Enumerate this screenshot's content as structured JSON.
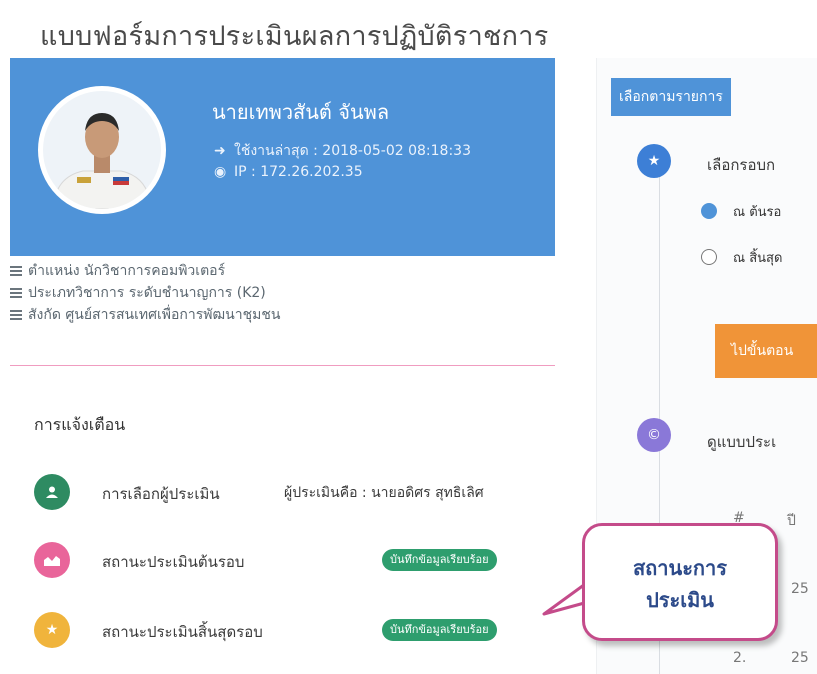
{
  "page": {
    "title": "แบบฟอร์มการประเมินผลการปฏิบัติราชการ"
  },
  "profile": {
    "name": "นายเทพวสันต์ จันพล",
    "last_login": "ใช้งานล่าสุด : 2018-05-02 08:18:33",
    "ip": "IP : 172.26.202.35",
    "info": [
      "ตำแหน่ง นักวิชาการคอมพิวเตอร์",
      "ประเภทวิชาการ ระดับชำนาญการ (K2)",
      "สังกัด ศูนย์สารสนเทศเพื่อการพัฒนาชุมชน"
    ]
  },
  "notifications": {
    "title": "การแจ้งเตือน",
    "items": [
      {
        "label": "การเลือกผู้ประเมิน",
        "value": "ผู้ประเมินคือ : นายอดิศร สุทธิเลิศ",
        "color": "#2e8b62"
      },
      {
        "label": "สถานะประเมินต้นรอบ",
        "badge": "บันทึกข้อมูลเรียบร้อย",
        "color": "#e9659a"
      },
      {
        "label": "สถานะประเมินสิ้นสุดรอบ",
        "badge": "บันทึกข้อมูลเรียบร้อย",
        "color": "#f0b43c"
      }
    ]
  },
  "sidebar": {
    "tab_label": "เลือกตามรายการ",
    "step1_label": "เลือกรอบก",
    "radio_start": "ณ ต้นรอ",
    "radio_end": "ณ สิ้นสุด",
    "next_button": "ไปขั้นตอน",
    "step2_label": "ดูแบบประเ",
    "table_header_num": "#",
    "table_header_col": "ปี",
    "rows": [
      {
        "num": "",
        "value": "25"
      },
      {
        "num": "2.",
        "value": "25"
      }
    ],
    "step1_color": "#3d7fd6",
    "step2_color": "#8a78d8"
  },
  "callout": {
    "line1": "สถานะการ",
    "line2": "ประเมิน"
  }
}
